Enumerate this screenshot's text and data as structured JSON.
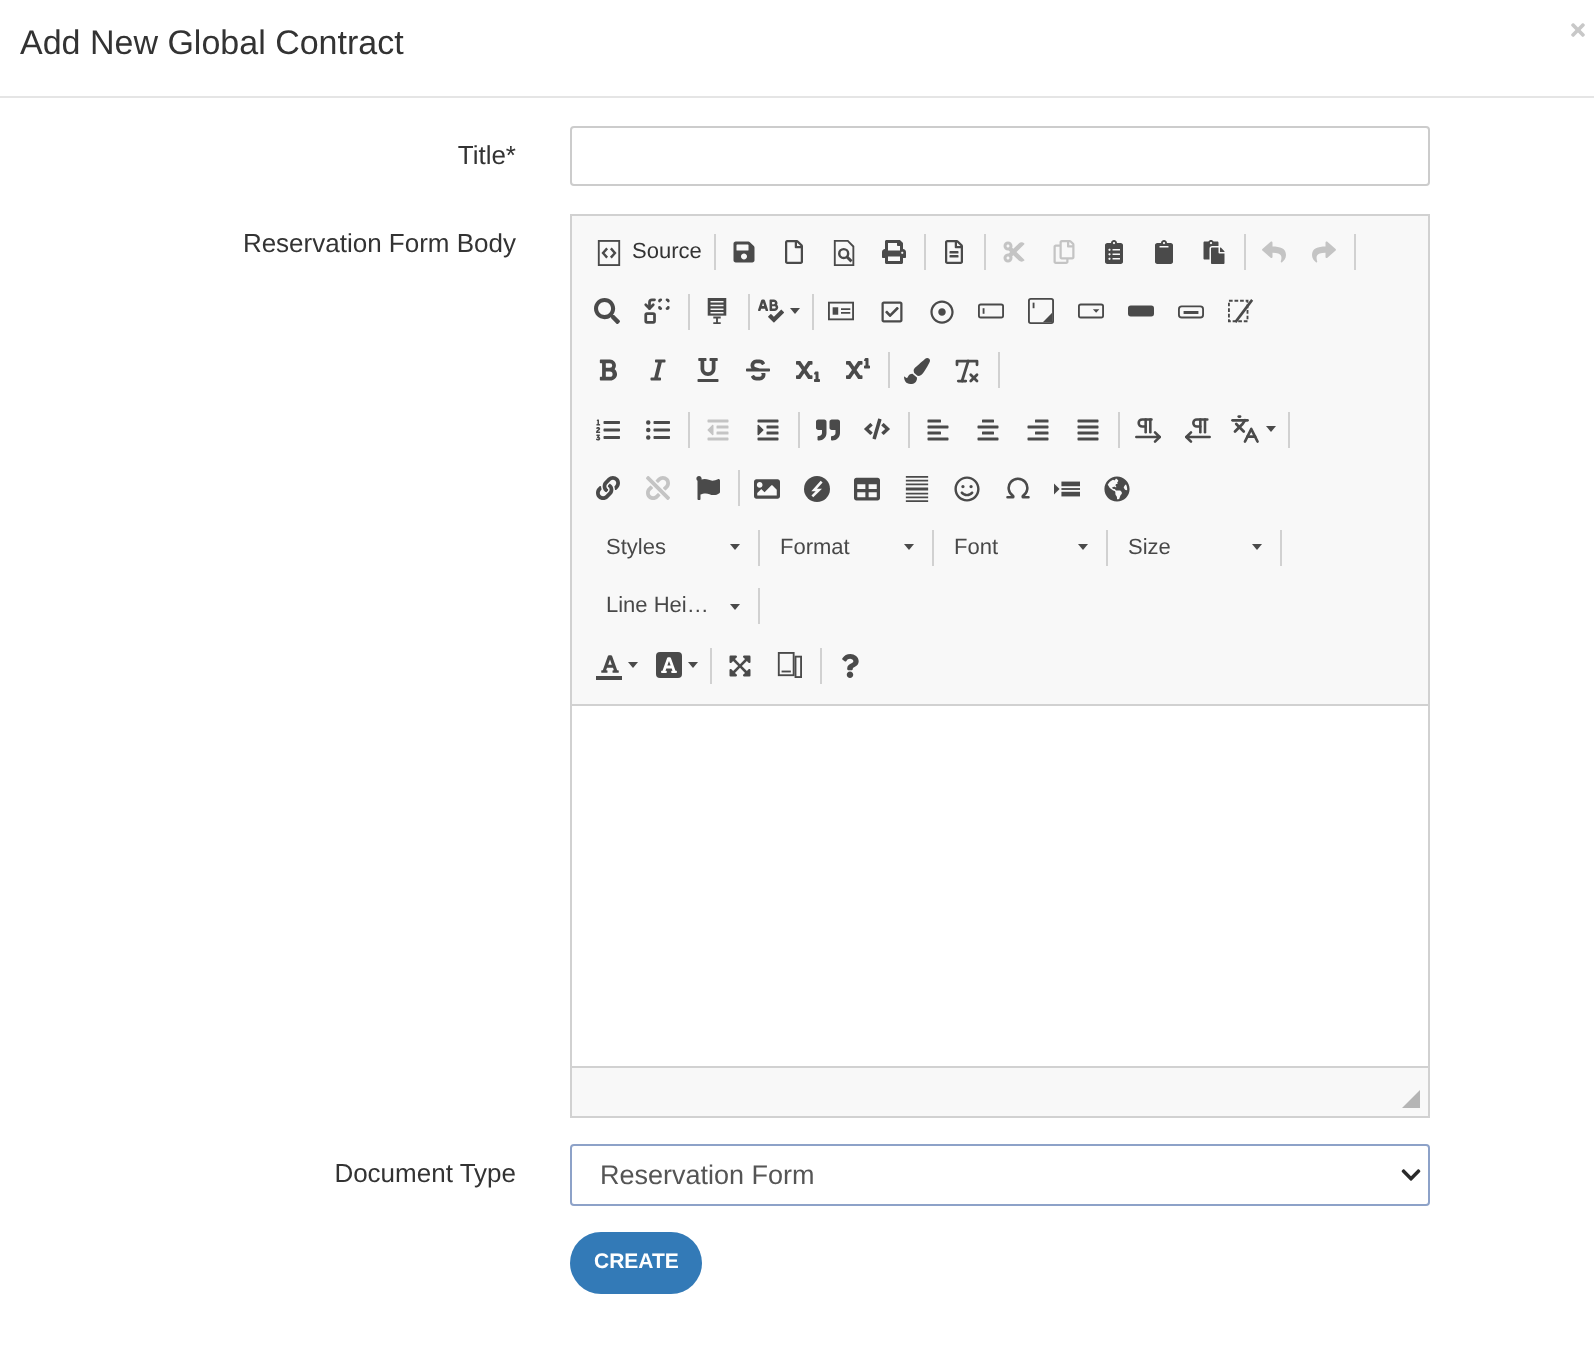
{
  "dialog": {
    "title": "Add New Global Contract"
  },
  "form": {
    "title_field": {
      "label": "Title*"
    },
    "body_editor": {
      "label": "Reservation Form Body",
      "toolbar": {
        "rows": [
          {
            "groups": [
              {
                "separator": true,
                "items": [
                  {
                    "kind": "source",
                    "label": "Source",
                    "disabled": false
                  }
                ]
              },
              {
                "separator": true,
                "items": [
                  {
                    "kind": "save",
                    "disabled": false
                  },
                  {
                    "kind": "newpage",
                    "disabled": false
                  },
                  {
                    "kind": "preview",
                    "disabled": false
                  },
                  {
                    "kind": "print",
                    "disabled": false
                  }
                ]
              },
              {
                "separator": true,
                "items": [
                  {
                    "kind": "templates",
                    "disabled": false
                  }
                ]
              },
              {
                "separator": true,
                "items": [
                  {
                    "kind": "cut",
                    "disabled": true
                  },
                  {
                    "kind": "copy",
                    "disabled": true
                  },
                  {
                    "kind": "paste",
                    "disabled": false
                  },
                  {
                    "kind": "pastetext",
                    "disabled": false
                  },
                  {
                    "kind": "pastefromword",
                    "disabled": false
                  }
                ]
              },
              {
                "separator": true,
                "items": [
                  {
                    "kind": "undo",
                    "disabled": true
                  },
                  {
                    "kind": "redo",
                    "disabled": true
                  }
                ]
              }
            ]
          },
          {
            "groups": [
              {
                "separator": true,
                "items": [
                  {
                    "kind": "find",
                    "disabled": false
                  },
                  {
                    "kind": "replace",
                    "disabled": false
                  }
                ]
              },
              {
                "separator": true,
                "items": [
                  {
                    "kind": "selectall",
                    "disabled": false
                  }
                ]
              },
              {
                "separator": true,
                "items": [
                  {
                    "kind": "spellcheck",
                    "disabled": false
                  }
                ]
              },
              {
                "separator": false,
                "items": [
                  {
                    "kind": "form",
                    "disabled": false
                  },
                  {
                    "kind": "checkbox",
                    "disabled": false
                  },
                  {
                    "kind": "radio",
                    "disabled": false
                  },
                  {
                    "kind": "textfield",
                    "disabled": false
                  },
                  {
                    "kind": "textarea",
                    "disabled": false
                  },
                  {
                    "kind": "select",
                    "disabled": false
                  },
                  {
                    "kind": "button",
                    "disabled": false
                  },
                  {
                    "kind": "imagebutton",
                    "disabled": false
                  },
                  {
                    "kind": "hiddenfield",
                    "disabled": false
                  }
                ]
              }
            ]
          },
          {
            "groups": [
              {
                "separator": true,
                "items": [
                  {
                    "kind": "bold",
                    "disabled": false
                  },
                  {
                    "kind": "italic",
                    "disabled": false
                  },
                  {
                    "kind": "underline",
                    "disabled": false
                  },
                  {
                    "kind": "strike",
                    "disabled": false
                  },
                  {
                    "kind": "subscript",
                    "disabled": false
                  },
                  {
                    "kind": "superscript",
                    "disabled": false
                  }
                ]
              },
              {
                "separator": true,
                "items": [
                  {
                    "kind": "copyformatting",
                    "disabled": false
                  },
                  {
                    "kind": "removeformat",
                    "disabled": false
                  }
                ]
              }
            ]
          },
          {
            "groups": [
              {
                "separator": true,
                "items": [
                  {
                    "kind": "numberedlist",
                    "disabled": false
                  },
                  {
                    "kind": "bulletedlist",
                    "disabled": false
                  }
                ]
              },
              {
                "separator": true,
                "items": [
                  {
                    "kind": "outdent",
                    "disabled": true
                  },
                  {
                    "kind": "indent",
                    "disabled": false
                  }
                ]
              },
              {
                "separator": true,
                "items": [
                  {
                    "kind": "blockquote",
                    "disabled": false
                  },
                  {
                    "kind": "creatediv",
                    "disabled": false
                  }
                ]
              },
              {
                "separator": true,
                "items": [
                  {
                    "kind": "alignleft",
                    "disabled": false
                  },
                  {
                    "kind": "aligncenter",
                    "disabled": false
                  },
                  {
                    "kind": "alignright",
                    "disabled": false
                  },
                  {
                    "kind": "alignjustify",
                    "disabled": false
                  }
                ]
              },
              {
                "separator": true,
                "items": [
                  {
                    "kind": "bidiltr",
                    "disabled": false
                  },
                  {
                    "kind": "bidirtl",
                    "disabled": false
                  },
                  {
                    "kind": "language",
                    "disabled": false
                  }
                ]
              }
            ]
          },
          {
            "groups": [
              {
                "separator": true,
                "items": [
                  {
                    "kind": "link",
                    "disabled": false
                  },
                  {
                    "kind": "unlink",
                    "disabled": true
                  },
                  {
                    "kind": "anchor",
                    "disabled": false
                  }
                ]
              },
              {
                "separator": false,
                "items": [
                  {
                    "kind": "image",
                    "disabled": false
                  },
                  {
                    "kind": "flash",
                    "disabled": false
                  },
                  {
                    "kind": "table",
                    "disabled": false
                  },
                  {
                    "kind": "horizontalrule",
                    "disabled": false
                  },
                  {
                    "kind": "smiley",
                    "disabled": false
                  },
                  {
                    "kind": "specialchar",
                    "disabled": false
                  },
                  {
                    "kind": "pagebreak",
                    "disabled": false
                  },
                  {
                    "kind": "iframe",
                    "disabled": false
                  }
                ]
              }
            ]
          },
          {
            "groups": [
              {
                "separator": true,
                "items": [
                  {
                    "kind": "combo",
                    "label": "Styles",
                    "disabled": false
                  }
                ]
              },
              {
                "separator": true,
                "items": [
                  {
                    "kind": "combo",
                    "label": "Format",
                    "disabled": false
                  }
                ]
              },
              {
                "separator": true,
                "items": [
                  {
                    "kind": "combo",
                    "label": "Font",
                    "disabled": false
                  }
                ]
              },
              {
                "separator": true,
                "items": [
                  {
                    "kind": "combo",
                    "label": "Size",
                    "disabled": false
                  }
                ]
              }
            ]
          },
          {
            "groups": [
              {
                "separator": true,
                "items": [
                  {
                    "kind": "combo",
                    "label": "Line Hei…",
                    "disabled": false
                  }
                ]
              }
            ]
          },
          {
            "groups": [
              {
                "separator": true,
                "items": [
                  {
                    "kind": "textcolor",
                    "disabled": false
                  },
                  {
                    "kind": "bgcolor",
                    "disabled": false
                  }
                ]
              },
              {
                "separator": true,
                "items": [
                  {
                    "kind": "maximize",
                    "disabled": false
                  },
                  {
                    "kind": "showblocks",
                    "disabled": false
                  }
                ]
              },
              {
                "separator": false,
                "items": [
                  {
                    "kind": "about",
                    "disabled": false
                  }
                ]
              }
            ]
          }
        ]
      }
    },
    "document_type": {
      "label": "Document Type",
      "value": "Reservation Form"
    },
    "create_button": {
      "label": "CREATE"
    }
  }
}
